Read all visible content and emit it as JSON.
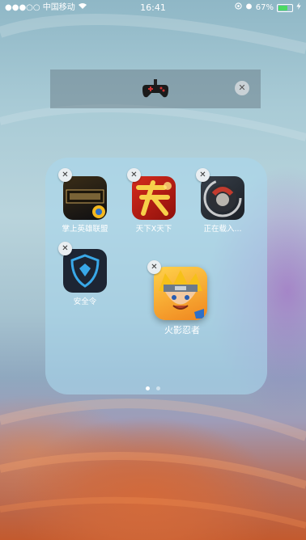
{
  "status_bar": {
    "carrier": "●●●○○ 中国移动",
    "time": "16:41",
    "battery_percent": "67%",
    "battery_level": 0.67,
    "battery_color": "#4cd964"
  },
  "drag_bar": {
    "icon": "gamepad-icon",
    "close_symbol": "✕"
  },
  "folder": {
    "apps": [
      {
        "label": "掌上英雄联盟",
        "icon": "lol-icon",
        "delete": "✕"
      },
      {
        "label": "天下X天下",
        "icon": "tianxia-icon",
        "delete": "✕"
      },
      {
        "label": "正在载入...",
        "icon": "loading-app-icon",
        "delete": "✕"
      },
      {
        "label": "安全令",
        "icon": "shield-icon",
        "delete": "✕"
      },
      {
        "label": "火影忍者",
        "icon": "naruto-icon",
        "delete": "✕"
      }
    ],
    "page_count": 2,
    "current_page": 1
  }
}
